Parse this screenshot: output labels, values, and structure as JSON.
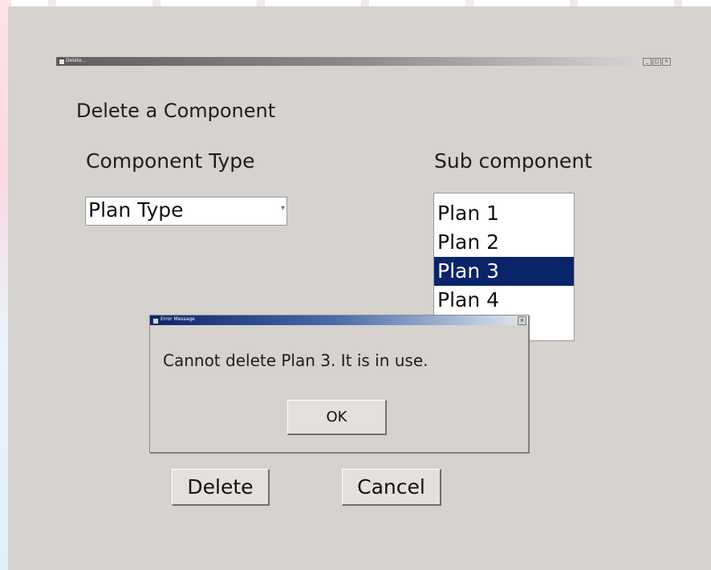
{
  "window": {
    "title_text": "Delete...",
    "minimize_label": "_",
    "maximize_label": "□",
    "close_label": "×"
  },
  "form": {
    "heading": "Delete a Component",
    "component_type_label": "Component Type",
    "component_type_value": "Plan Type",
    "sub_component_label": "Sub component",
    "sub_components": [
      {
        "label": "Plan 1",
        "selected": false
      },
      {
        "label": "Plan 2",
        "selected": false
      },
      {
        "label": "Plan 3",
        "selected": true
      },
      {
        "label": "Plan 4",
        "selected": false
      }
    ],
    "delete_button": "Delete",
    "cancel_button": "Cancel"
  },
  "dialog": {
    "title": "Error Message",
    "close_label": "×",
    "message": "Cannot delete Plan 3. It is in use.",
    "ok_button": "OK"
  },
  "colors": {
    "window_bg": "#d6d2ce",
    "selection_bg": "#0a246a",
    "selection_text": "#ffffff"
  }
}
